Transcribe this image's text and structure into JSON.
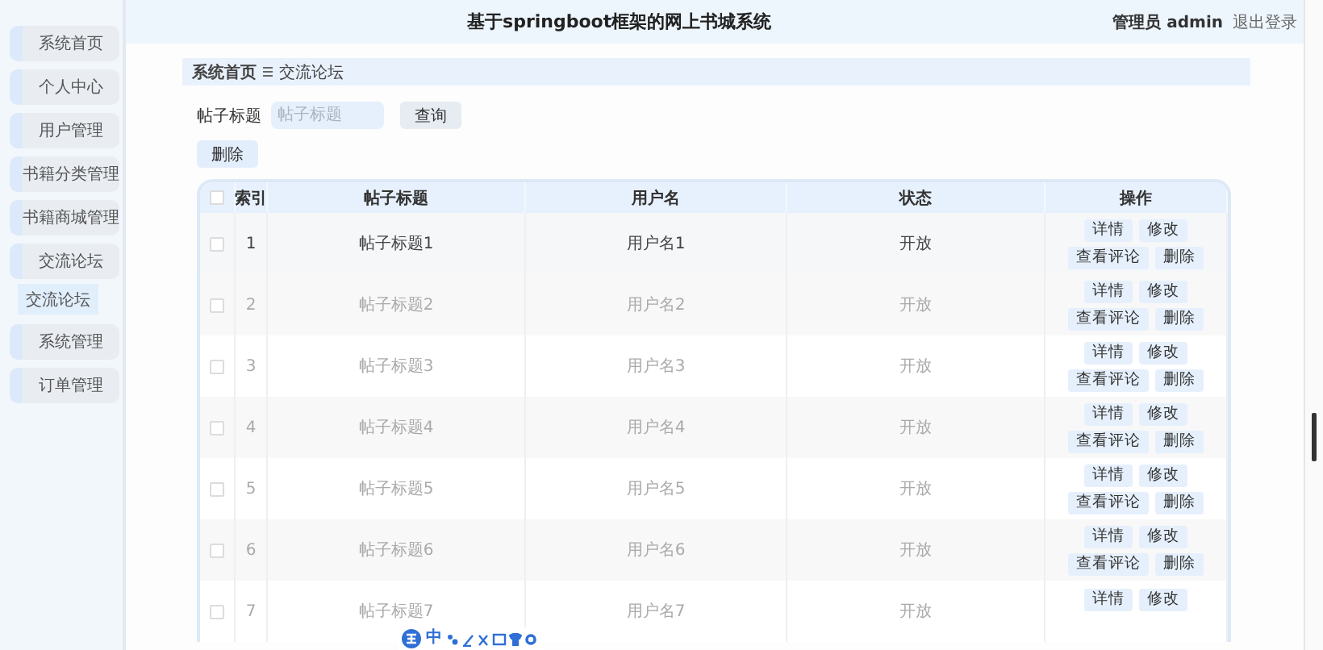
{
  "header": {
    "title": "基于springboot框架的网上书城系统",
    "user": "管理员 admin",
    "logout": "退出登录"
  },
  "sidebar": {
    "items": [
      {
        "label": "系统首页"
      },
      {
        "label": "个人中心"
      },
      {
        "label": "用户管理"
      },
      {
        "label": "书籍分类管理"
      },
      {
        "label": "书籍商城管理"
      },
      {
        "label": "交流论坛",
        "children": [
          {
            "label": "交流论坛",
            "selected": true
          }
        ]
      },
      {
        "label": "系统管理"
      },
      {
        "label": "订单管理"
      }
    ]
  },
  "breadcrumb": [
    "系统首页",
    "交流论坛"
  ],
  "search": {
    "label": "帖子标题",
    "placeholder": "帖子标题",
    "button": "查询"
  },
  "delete_button": "删除",
  "table": {
    "all_checked": false,
    "columns": [
      "索引",
      "帖子标题",
      "用户名",
      "状态",
      "操作"
    ],
    "rows": [
      {
        "index": "1",
        "title": "帖子标题1",
        "username": "用户名1",
        "status": "开放",
        "checked": false,
        "hovered": true,
        "actions": [
          "详情",
          "修改",
          "查看评论",
          "删除"
        ]
      },
      {
        "index": "2",
        "title": "帖子标题2",
        "username": "用户名2",
        "status": "开放",
        "checked": false,
        "hovered": false,
        "actions": [
          "详情",
          "修改",
          "查看评论",
          "删除"
        ]
      },
      {
        "index": "3",
        "title": "帖子标题3",
        "username": "用户名3",
        "status": "开放",
        "checked": false,
        "hovered": false,
        "actions": [
          "详情",
          "修改",
          "查看评论",
          "删除"
        ]
      },
      {
        "index": "4",
        "title": "帖子标题4",
        "username": "用户名4",
        "status": "开放",
        "checked": false,
        "hovered": false,
        "actions": [
          "详情",
          "修改",
          "查看评论",
          "删除"
        ]
      },
      {
        "index": "5",
        "title": "帖子标题5",
        "username": "用户名5",
        "status": "开放",
        "checked": false,
        "hovered": false,
        "actions": [
          "详情",
          "修改",
          "查看评论",
          "删除"
        ]
      },
      {
        "index": "6",
        "title": "帖子标题6",
        "username": "用户名6",
        "status": "开放",
        "checked": false,
        "hovered": false,
        "actions": [
          "详情",
          "修改",
          "查看评论",
          "删除"
        ]
      },
      {
        "index": "7",
        "title": "帖子标题7",
        "username": "用户名7",
        "status": "开放",
        "checked": false,
        "hovered": false,
        "actions": [
          "详情",
          "修改"
        ]
      }
    ]
  },
  "ime_toolbar": {
    "mode": "中"
  }
}
